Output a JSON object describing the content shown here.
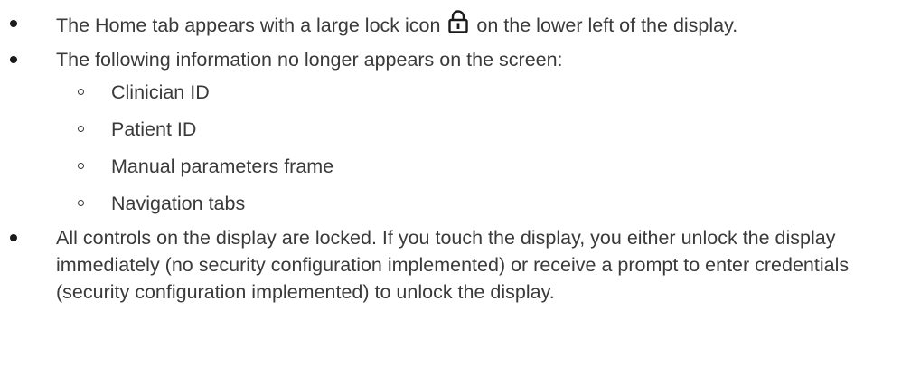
{
  "bullets": [
    {
      "text_before_icon": "The Home tab appears with a large lock icon",
      "icon": "lock-icon",
      "text_after_icon": "on the lower left of the display."
    },
    {
      "text": "The following information no longer appears on the screen:",
      "sub_items": [
        "Clinician ID",
        "Patient ID",
        "Manual parameters frame",
        "Navigation tabs"
      ]
    },
    {
      "text": "All controls on the display are locked. If you touch the display, you either unlock the display immediately (no security configuration implemented) or receive a prompt to enter credentials (security configuration implemented) to unlock the display."
    }
  ],
  "colors": {
    "text": "#3a3a3a",
    "bullet": "#1a1a1a"
  }
}
